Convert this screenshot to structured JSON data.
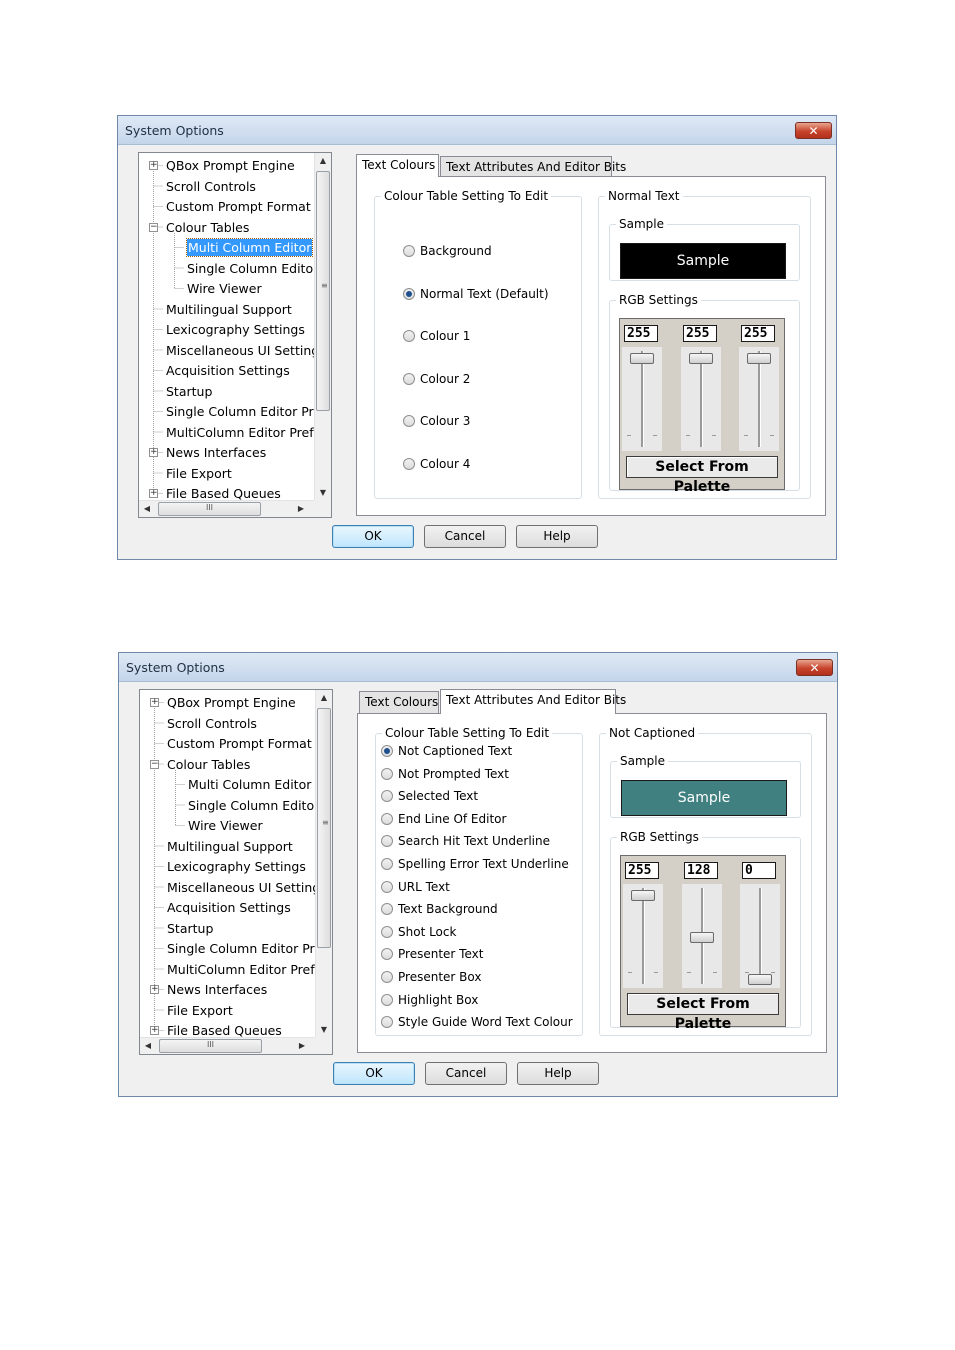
{
  "dialogs": [
    {
      "title": "System Options",
      "close_label": "✕",
      "tree": {
        "items": [
          {
            "label": "QBox Prompt Engine",
            "expander": "+"
          },
          {
            "label": "Scroll Controls"
          },
          {
            "label": "Custom Prompt Format"
          },
          {
            "label": "Colour Tables",
            "expander": "−"
          },
          {
            "label": "Multi Column Editor",
            "selected": true
          },
          {
            "label": "Single Column Edito"
          },
          {
            "label": "Wire Viewer"
          },
          {
            "label": "Multilingual Support"
          },
          {
            "label": "Lexicography Settings"
          },
          {
            "label": "Miscellaneous UI Setting"
          },
          {
            "label": "Acquisition Settings"
          },
          {
            "label": "Startup"
          },
          {
            "label": "Single Column Editor Pr"
          },
          {
            "label": "MultiColumn Editor Pref"
          },
          {
            "label": "News Interfaces",
            "expander": "+"
          },
          {
            "label": "File Export"
          },
          {
            "label": "File Based Queues",
            "expander": "+"
          }
        ],
        "hscroll_grip": "III",
        "vscroll_grip": "≡"
      },
      "tabs": [
        {
          "label": "Text Colours",
          "active": true
        },
        {
          "label": "Text Attributes And Editor Bits",
          "active": false
        }
      ],
      "colour_table": {
        "legend": "Colour Table Setting To Edit",
        "options": [
          {
            "label": "Background",
            "checked": false
          },
          {
            "label": "Normal Text (Default)",
            "checked": true
          },
          {
            "label": "Colour 1",
            "checked": false
          },
          {
            "label": "Colour 2",
            "checked": false
          },
          {
            "label": "Colour 3",
            "checked": false
          },
          {
            "label": "Colour 4",
            "checked": false
          }
        ]
      },
      "preview": {
        "legend": "Normal Text",
        "sample_legend": "Sample",
        "sample_text": "Sample",
        "sample_bg": "#000000",
        "rgb_legend": "RGB Settings",
        "rgb": {
          "r": "255",
          "g": "255",
          "b": "255"
        },
        "rgb_levels": [
          255,
          255,
          255
        ],
        "palette_button": "Select From Palette"
      },
      "buttons": {
        "ok": "OK",
        "cancel": "Cancel",
        "help": "Help"
      }
    },
    {
      "title": "System Options",
      "close_label": "✕",
      "tree": {
        "items": [
          {
            "label": "QBox Prompt Engine",
            "expander": "+"
          },
          {
            "label": "Scroll Controls"
          },
          {
            "label": "Custom Prompt Format"
          },
          {
            "label": "Colour Tables",
            "expander": "−"
          },
          {
            "label": "Multi Column Editor"
          },
          {
            "label": "Single Column Edito"
          },
          {
            "label": "Wire Viewer"
          },
          {
            "label": "Multilingual Support"
          },
          {
            "label": "Lexicography Settings"
          },
          {
            "label": "Miscellaneous UI Setting"
          },
          {
            "label": "Acquisition Settings"
          },
          {
            "label": "Startup"
          },
          {
            "label": "Single Column Editor Pr"
          },
          {
            "label": "MultiColumn Editor Pref"
          },
          {
            "label": "News Interfaces",
            "expander": "+"
          },
          {
            "label": "File Export"
          },
          {
            "label": "File Based Queues",
            "expander": "+"
          }
        ],
        "hscroll_grip": "III",
        "vscroll_grip": "≡"
      },
      "tabs": [
        {
          "label": "Text Colours",
          "active": false
        },
        {
          "label": "Text Attributes And Editor Bits",
          "active": true
        }
      ],
      "colour_table": {
        "legend": "Colour Table Setting To Edit",
        "options": [
          {
            "label": "Not Captioned Text",
            "checked": true
          },
          {
            "label": "Not Prompted Text",
            "checked": false
          },
          {
            "label": "Selected Text",
            "checked": false
          },
          {
            "label": "End Line Of Editor",
            "checked": false
          },
          {
            "label": "Search Hit Text Underline",
            "checked": false
          },
          {
            "label": "Spelling Error Text Underline",
            "checked": false
          },
          {
            "label": "URL Text",
            "checked": false
          },
          {
            "label": "Text Background",
            "checked": false
          },
          {
            "label": "Shot Lock",
            "checked": false
          },
          {
            "label": "Presenter Text",
            "checked": false
          },
          {
            "label": "Presenter Box",
            "checked": false
          },
          {
            "label": "Highlight Box",
            "checked": false
          },
          {
            "label": "Style Guide Word Text Colour",
            "checked": false
          }
        ]
      },
      "preview": {
        "legend": "Not Captioned",
        "sample_legend": "Sample",
        "sample_text": "Sample",
        "sample_bg": "#408080",
        "rgb_legend": "RGB Settings",
        "rgb": {
          "r": "255",
          "g": "128",
          "b": "0"
        },
        "rgb_levels": [
          255,
          128,
          0
        ],
        "palette_button": "Select From Palette"
      },
      "buttons": {
        "ok": "OK",
        "cancel": "Cancel",
        "help": "Help"
      }
    }
  ]
}
